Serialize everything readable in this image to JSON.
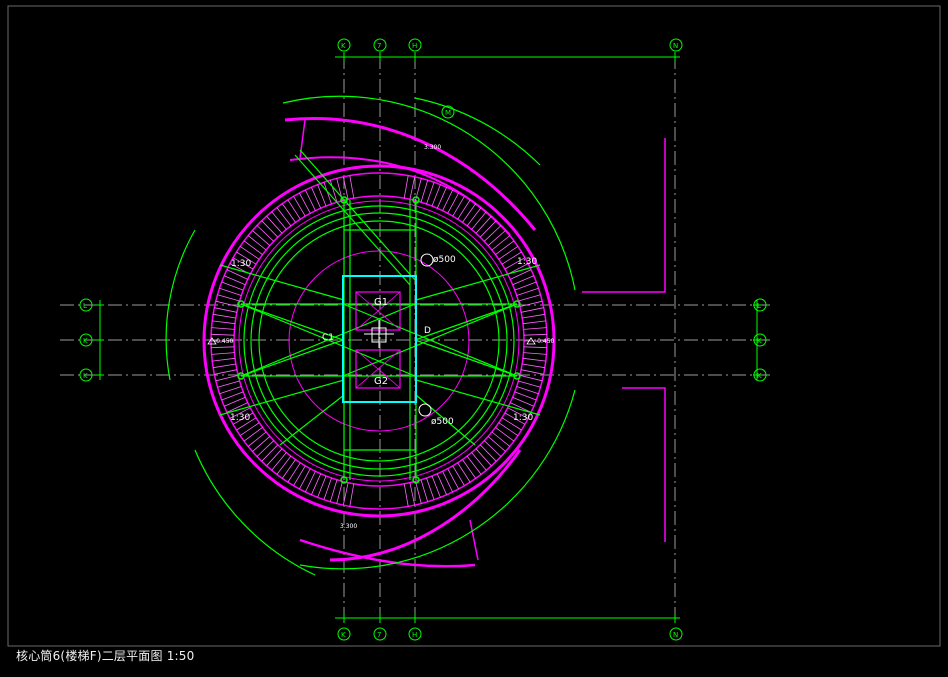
{
  "drawing": {
    "caption": "核心筒6(楼梯F)二层平面图 1:50",
    "grid_axes": {
      "top": [
        "K",
        "7",
        "H",
        "N"
      ],
      "bottom": [
        "K",
        "7",
        "H",
        "N"
      ],
      "left": [
        "L",
        "K",
        "K"
      ],
      "right": [
        "L",
        "K",
        "K"
      ],
      "ring": "M"
    },
    "columns": [
      "G1",
      "G2"
    ],
    "labels": {
      "pipe_top": "ø500",
      "pipe_bottom": "ø500",
      "node_c": "C1",
      "node_d": "D",
      "slope_nw": "1:30",
      "slope_ne": "1:30",
      "slope_sw": "1:30",
      "slope_se": "1:30",
      "elev_left": "-0.450",
      "elev_right": "-0.450",
      "elev_top": "3.300",
      "elev_bottom": "3.300"
    },
    "colors": {
      "background": "#000000",
      "grid": "#00ff00",
      "stairs": "#ff00ff",
      "axis_line": "#9a9a9a",
      "columns": "#00ffff",
      "text": "#ffffff"
    }
  }
}
